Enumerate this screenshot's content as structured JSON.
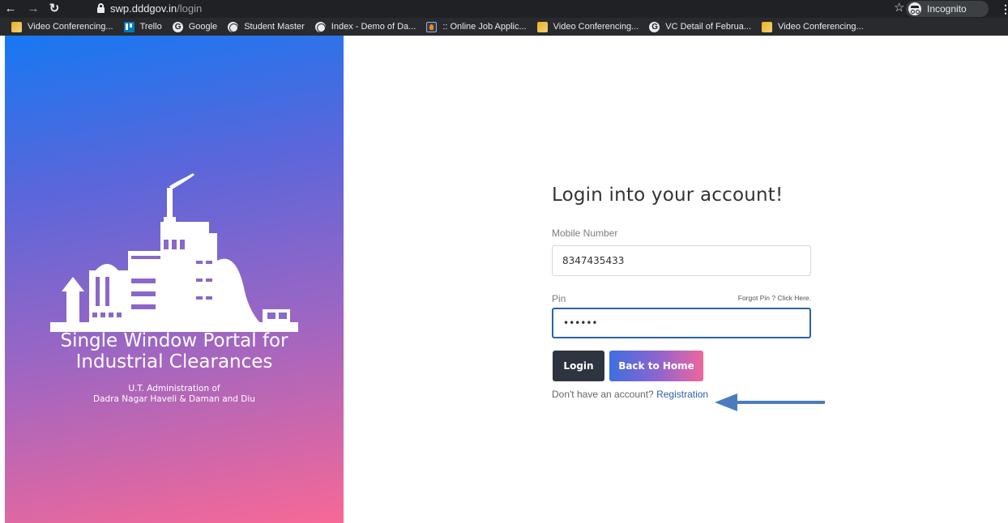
{
  "browser": {
    "url_host": "swp.dddgov.in",
    "url_path": "/login",
    "incognito_label": "Incognito",
    "bookmarks": [
      {
        "label": "Video Conferencing...",
        "icon": "vc-icon"
      },
      {
        "label": "Trello",
        "icon": "trello-icon"
      },
      {
        "label": "Google",
        "icon": "google-icon"
      },
      {
        "label": "Student Master",
        "icon": "globe-icon"
      },
      {
        "label": "Index - Demo of Da...",
        "icon": "globe-icon"
      },
      {
        "label": ":: Online Job Applic...",
        "icon": "job-icon"
      },
      {
        "label": "Video Conferencing...",
        "icon": "vc-icon"
      },
      {
        "label": "VC Detail of Februa...",
        "icon": "google-icon"
      },
      {
        "label": "Video Conferencing...",
        "icon": "vc-icon"
      }
    ]
  },
  "brand": {
    "title_line1": "Single Window Portal for",
    "title_line2": "Industrial Clearances",
    "sub_line1": "U.T. Administration of",
    "sub_line2": "Dadra Nagar Haveli & Daman and Diu"
  },
  "login": {
    "heading": "Login into your account!",
    "mobile_label": "Mobile Number",
    "mobile_value": "8347435433",
    "pin_label": "Pin",
    "forgot_text": "Forgot Pin ? Click Here.",
    "pin_value": "••••••",
    "login_button": "Login",
    "home_button": "Back to Home",
    "no_account_text": "Don't have an account?",
    "registration_link": "Registration"
  },
  "colors": {
    "arrow": "#4a7cbf",
    "dark_button": "#2e3440",
    "link": "#2e5fa8"
  }
}
